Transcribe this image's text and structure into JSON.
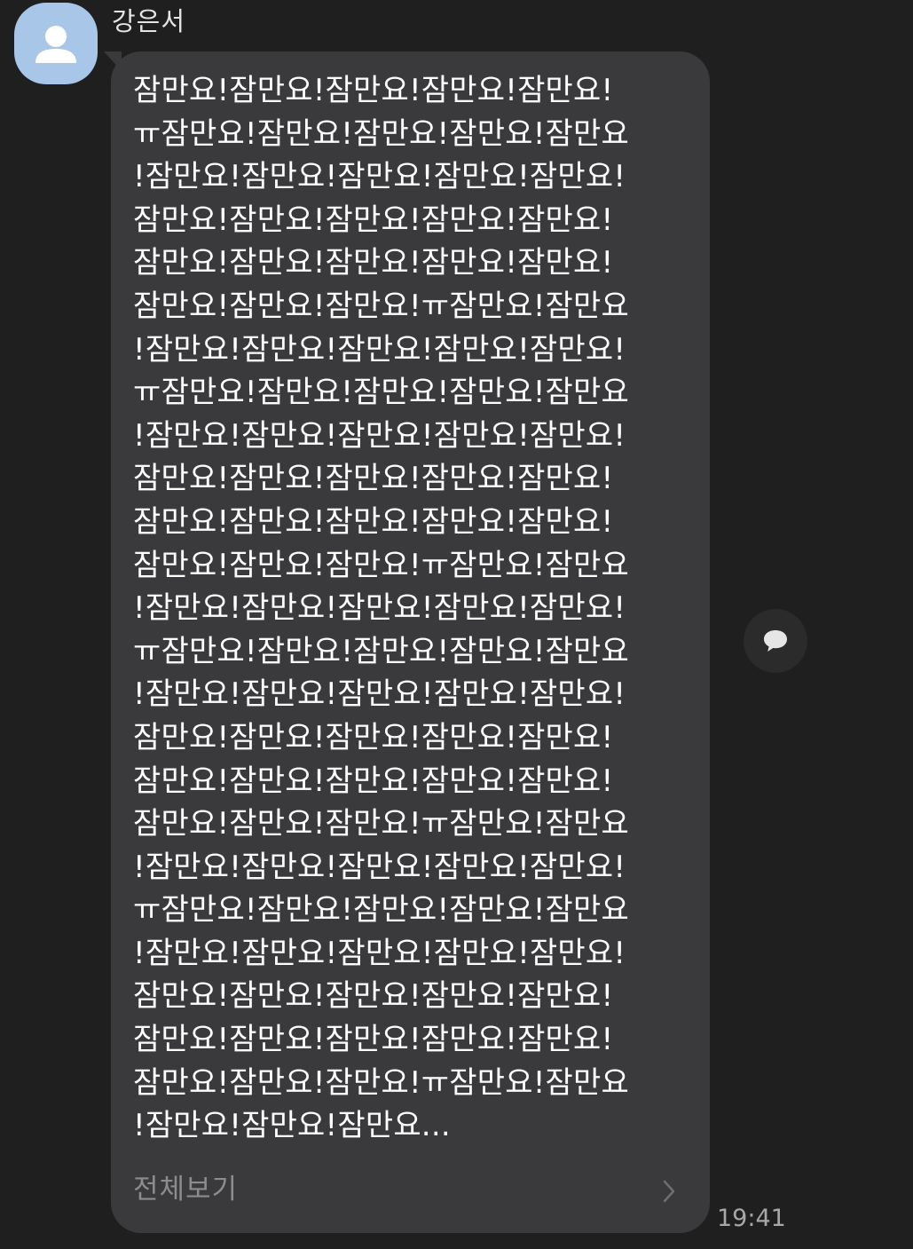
{
  "message": {
    "sender_name": "강은서",
    "avatar_icon": "default-person-icon",
    "lines": [
      "잠만요!잠만요!잠만요!잠만요!잠만요!",
      "ㅠ잠만요!잠만요!잠만요!잠만요!잠만요",
      "!잠만요!잠만요!잠만요!잠만요!잠만요!",
      "잠만요!잠만요!잠만요!잠만요!잠만요!",
      "잠만요!잠만요!잠만요!잠만요!잠만요!",
      "잠만요!잠만요!잠만요!ㅠ잠만요!잠만요",
      "!잠만요!잠만요!잠만요!잠만요!잠만요!",
      "ㅠ잠만요!잠만요!잠만요!잠만요!잠만요",
      "!잠만요!잠만요!잠만요!잠만요!잠만요!",
      "잠만요!잠만요!잠만요!잠만요!잠만요!",
      "잠만요!잠만요!잠만요!잠만요!잠만요!",
      "잠만요!잠만요!잠만요!ㅠ잠만요!잠만요",
      "!잠만요!잠만요!잠만요!잠만요!잠만요!",
      "ㅠ잠만요!잠만요!잠만요!잠만요!잠만요",
      "!잠만요!잠만요!잠만요!잠만요!잠만요!",
      "잠만요!잠만요!잠만요!잠만요!잠만요!",
      "잠만요!잠만요!잠만요!잠만요!잠만요!",
      "잠만요!잠만요!잠만요!ㅠ잠만요!잠만요",
      "!잠만요!잠만요!잠만요!잠만요!잠만요!",
      "ㅠ잠만요!잠만요!잠만요!잠만요!잠만요",
      "!잠만요!잠만요!잠만요!잠만요!잠만요!",
      "잠만요!잠만요!잠만요!잠만요!잠만요!",
      "잠만요!잠만요!잠만요!잠만요!잠만요!",
      "잠만요!잠만요!잠만요!ㅠ잠만요!잠만요",
      "!잠만요!잠만요!잠만요..."
    ],
    "read_more_label": "전체보기",
    "read_more_icon": "chevron-right-icon",
    "timestamp": "19:41",
    "reply_icon": "speech-bubble-icon"
  },
  "colors": {
    "background": "#1f1f1f",
    "bubble": "#3a3a3c",
    "avatar": "#a7c6e8",
    "text": "#ffffff",
    "muted_text": "#8c8c8e"
  }
}
